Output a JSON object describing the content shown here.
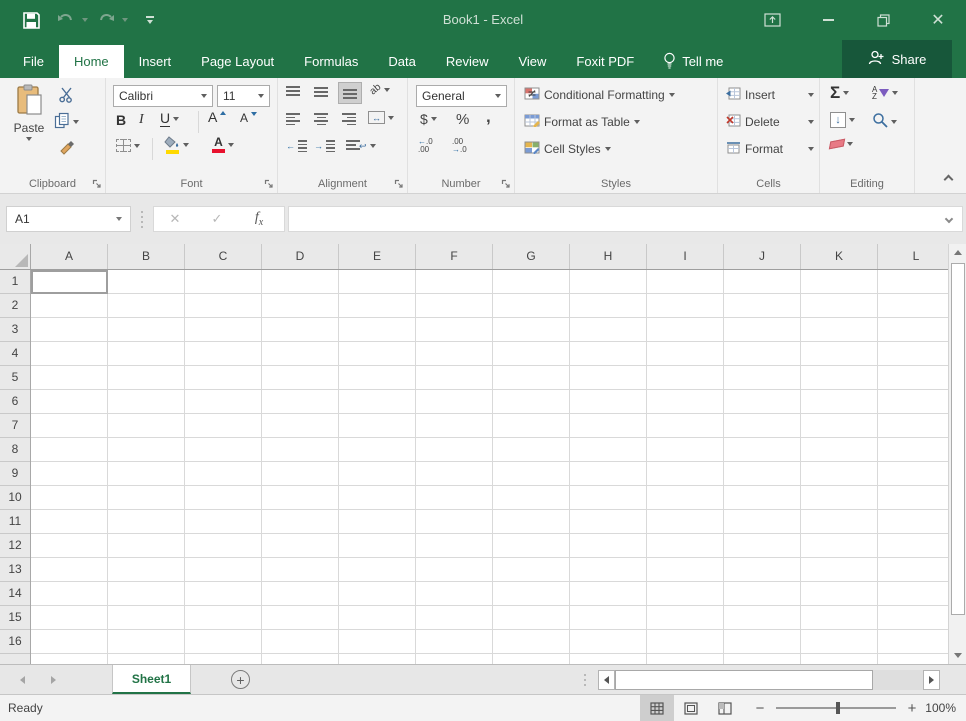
{
  "colors": {
    "accent": "#217346",
    "share_bg": "#17573a",
    "highlight_yellow": "#ffd900",
    "font_red": "#e8112d"
  },
  "titlebar": {
    "title": "Book1 - Excel"
  },
  "ribbon_tabs": {
    "items": [
      {
        "label": "File",
        "active": false
      },
      {
        "label": "Home",
        "active": true
      },
      {
        "label": "Insert",
        "active": false
      },
      {
        "label": "Page Layout",
        "active": false
      },
      {
        "label": "Formulas",
        "active": false
      },
      {
        "label": "Data",
        "active": false
      },
      {
        "label": "Review",
        "active": false
      },
      {
        "label": "View",
        "active": false
      },
      {
        "label": "Foxit PDF",
        "active": false
      }
    ],
    "tell_me": "Tell me",
    "share": "Share"
  },
  "ribbon": {
    "clipboard": {
      "label": "Clipboard",
      "paste": "Paste"
    },
    "font": {
      "label": "Font",
      "family": "Calibri",
      "size": "11",
      "bold": "B",
      "italic": "I",
      "underline": "U",
      "grow_letter": "A",
      "shrink_letter": "A",
      "font_color_letter": "A"
    },
    "alignment": {
      "label": "Alignment",
      "orientation_text": "ab"
    },
    "number": {
      "label": "Number",
      "format": "General",
      "currency": "$",
      "percent": "%",
      "comma": ",",
      "inc_top": "←.0",
      "inc_bottom": ".00",
      "dec_top": ".00",
      "dec_bottom": "→.0"
    },
    "styles": {
      "label": "Styles",
      "conditional": "Conditional Formatting",
      "format_table": "Format as Table",
      "cell_styles": "Cell Styles"
    },
    "cells": {
      "label": "Cells",
      "insert": "Insert",
      "delete": "Delete",
      "format": "Format"
    },
    "editing": {
      "label": "Editing",
      "autosum": "Σ",
      "sort_a": "A",
      "sort_z": "Z"
    }
  },
  "formula_bar": {
    "name_box": "A1",
    "cancel": "✕",
    "enter": "✓",
    "fx_f": "f",
    "fx_x": "x"
  },
  "grid": {
    "columns": [
      "A",
      "B",
      "C",
      "D",
      "E",
      "F",
      "G",
      "H",
      "I",
      "J",
      "K",
      "L"
    ],
    "rows": [
      "1",
      "2",
      "3",
      "4",
      "5",
      "6",
      "7",
      "8",
      "9",
      "10",
      "11",
      "12",
      "13",
      "14",
      "15",
      "16"
    ],
    "active_cell": "A1"
  },
  "sheet_bar": {
    "sheet": "Sheet1",
    "add": "+"
  },
  "status_bar": {
    "status": "Ready",
    "zoom": "100%"
  }
}
